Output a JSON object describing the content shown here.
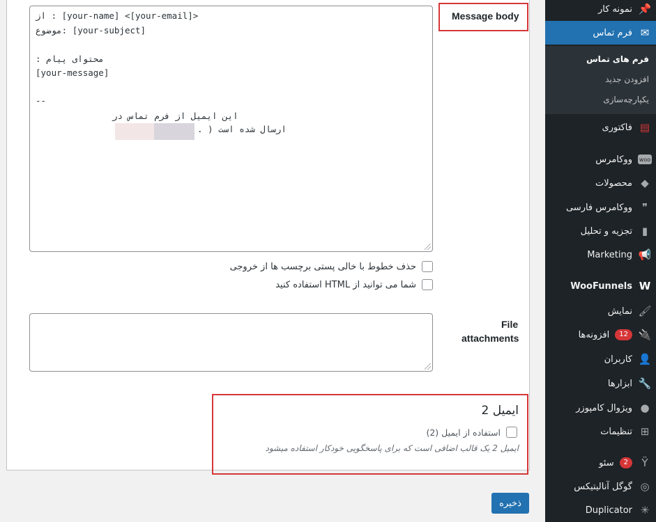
{
  "mail_body": {
    "label": "Message body",
    "line1": "از : [your-name] <[your-email]>",
    "line2": "موضوع: [your-subject]",
    "line3": "محتوای پیام :",
    "line4": "[your-message]",
    "line5": "--",
    "line6": "این ایمیل از فرم تماس در",
    "line7": "ارسال شده است ( ."
  },
  "options": {
    "exclude_blank": "حذف خطوط با خالی پستی برچسب ها از خروجی",
    "use_html": "شما می توانید از HTML استفاده کنید"
  },
  "attachments": {
    "label_line1": "File",
    "label_line2": "attachments"
  },
  "mail2": {
    "title": "ایمیل 2",
    "use_label": "استفاده از ایمیل (2)",
    "description": "ایمیل 2 یک قالب اضافی است که برای پاسخگویی خودکار استفاده میشود"
  },
  "save_label": "ذخیره",
  "sidebar": {
    "portfolio": "نمونه کار",
    "contact_form": "فرم تماس",
    "sub_forms": "فرم های تماس",
    "sub_add_new": "افزودن جدید",
    "sub_integration": "یکپارچه‌سازی",
    "factory": "فاکتوری",
    "woocommerce": "ووکامرس",
    "products": "محصولات",
    "woo_persian": "ووکامرس فارسی",
    "analytics": "تجزیه و تحلیل",
    "marketing": "Marketing",
    "woofunnels": "WooFunnels",
    "appearance": "نمایش",
    "plugins": "افزونه‌ها",
    "plugins_badge": "12",
    "users": "کاربران",
    "tools": "ابزارها",
    "visual_composer": "ویژوال کامپوزر",
    "settings": "تنظیمات",
    "seo": "سئو",
    "seo_badge": "2",
    "google_analytics": "گوگل آنالیتیکس",
    "duplicator": "Duplicator"
  },
  "colors": {
    "accent": "#2271b1",
    "highlight_box": "#d63638",
    "sidebar_bg": "#1d2327"
  }
}
